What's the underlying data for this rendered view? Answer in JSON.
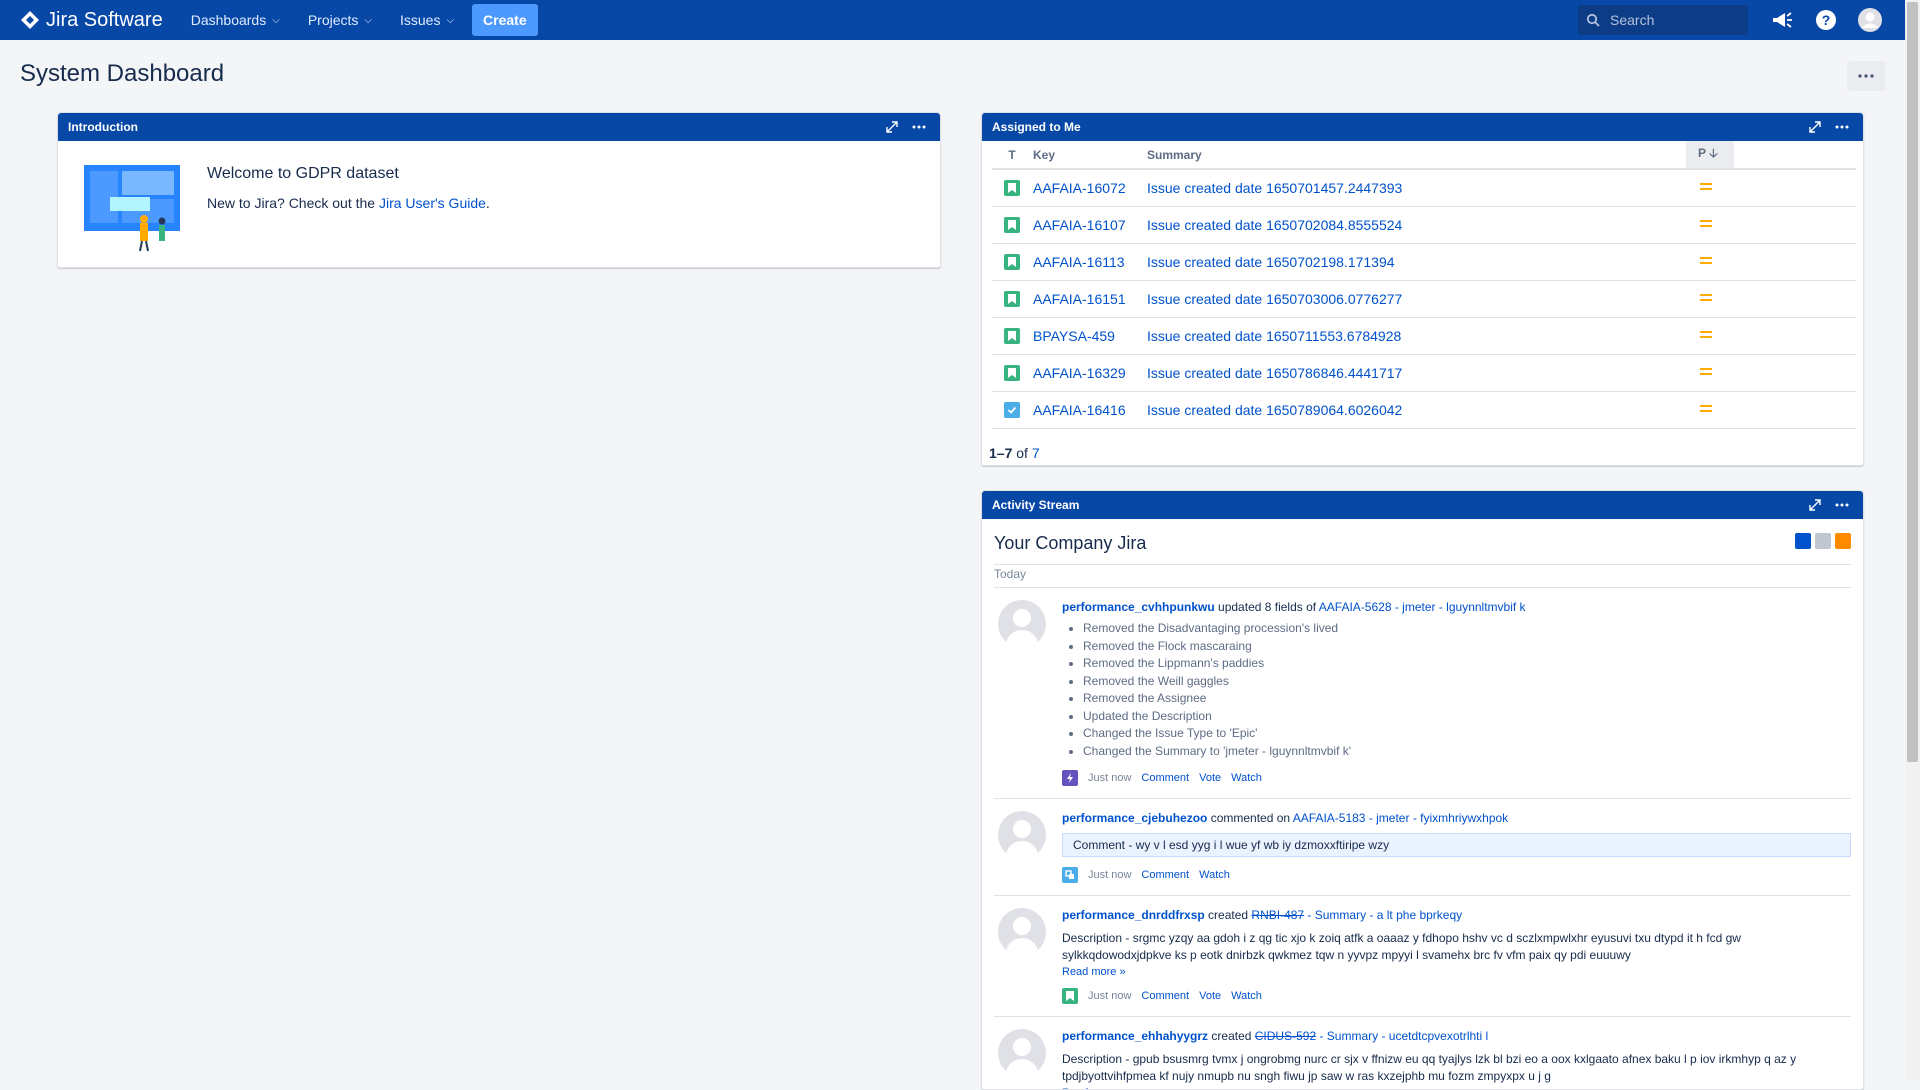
{
  "nav": {
    "product": "Jira Software",
    "menus": [
      "Dashboards",
      "Projects",
      "Issues"
    ],
    "create": "Create",
    "search_placeholder": "Search"
  },
  "page": {
    "title": "System Dashboard"
  },
  "intro": {
    "header": "Introduction",
    "welcome": "Welcome to GDPR dataset",
    "text_pre": "New to Jira? Check out the ",
    "link": "Jira User's Guide",
    "text_post": "."
  },
  "assigned": {
    "header": "Assigned to Me",
    "columns": {
      "type": "T",
      "key": "Key",
      "summary": "Summary",
      "priority": "P"
    },
    "rows": [
      {
        "type": "story",
        "key": "AAFAIA-16072",
        "summary": "Issue created date 1650701457.2447393"
      },
      {
        "type": "story",
        "key": "AAFAIA-16107",
        "summary": "Issue created date 1650702084.8555524"
      },
      {
        "type": "story",
        "key": "AAFAIA-16113",
        "summary": "Issue created date 1650702198.171394"
      },
      {
        "type": "story",
        "key": "AAFAIA-16151",
        "summary": "Issue created date 1650703006.0776277"
      },
      {
        "type": "story",
        "key": "BPAYSA-459",
        "summary": "Issue created date 1650711553.6784928"
      },
      {
        "type": "story",
        "key": "AAFAIA-16329",
        "summary": "Issue created date 1650786846.4441717"
      },
      {
        "type": "task",
        "key": "AAFAIA-16416",
        "summary": "Issue created date 1650789064.6026042"
      }
    ],
    "pager": {
      "range": "1–7",
      "of": " of ",
      "total": "7"
    }
  },
  "activity": {
    "header": "Activity Stream",
    "title": "Your Company Jira",
    "today": "Today",
    "entries": [
      {
        "user": "performance_cvhhpunkwu",
        "action": " updated 8 fields of ",
        "target": "AAFAIA-5628 - jmeter - lguynnltmvbif k",
        "changes": [
          "Removed the Disadvantaging procession's lived",
          "Removed the Flock mascaraing",
          "Removed the Lippmann's paddies",
          "Removed the Weill gaggles",
          "Removed the Assignee",
          "Updated the Description",
          "Changed the Issue Type to 'Epic'",
          "Changed the Summary to 'jmeter - lguynnltmvbif k'"
        ],
        "time": "Just now",
        "links": [
          "Comment",
          "Vote",
          "Watch"
        ]
      },
      {
        "user": "performance_cjebuhezoo",
        "action": " commented on ",
        "target": "AAFAIA-5183 - jmeter - fyixmhriywxhpok",
        "comment": "Comment - wy v l esd yyg i l wue yf wb iy dzmoxxftiripe wzy",
        "time": "Just now",
        "links": [
          "Comment",
          "Watch"
        ]
      },
      {
        "user": "performance_dnrddfrxsp",
        "action": " created ",
        "target_strike": "RNBI-487",
        "target": " - Summary - a lt phe bprkeqy",
        "description": "Description - srgmc yzqy aa gdoh i z qg tic xjo k zoiq atfk a oaaaz y fdhopo hshv vc d sczlxmpwlxhr eyusuvi txu dtypd it h fcd gw sylkkqdowodxjdpkve ks p eotk dnirbzk qwkmez tqw n yyvpz mpyyi l svamehx brc fv vfm paix qy pdi euuuwy",
        "readmore": "Read more »",
        "time": "Just now",
        "links": [
          "Comment",
          "Vote",
          "Watch"
        ]
      },
      {
        "user": "performance_ehhahyygrz",
        "action": " created ",
        "target_strike": "CIDUS-592",
        "target": " - Summary - ucetdtcpvexotrlhti l",
        "description": "Description - gpub bsusmrg tvmx j ongrobmg nurc cr sjx v ffnizw eu qq tyajlys lzk bl bzi eo a oox kxlgaato afnex baku l p iov irkmhyp q az y tpdjbyottvihfpmea kf nujy nmupb nu sngh fiwu jp saw w ras kxzejphb mu fozm zmpyxpx u j g",
        "readmore": "Read more »"
      }
    ]
  },
  "colors": {
    "nav": "#0747a6",
    "link": "#0052cc",
    "story": "#36b37e",
    "task": "#4bade8",
    "priority_medium": "#ffab00"
  }
}
